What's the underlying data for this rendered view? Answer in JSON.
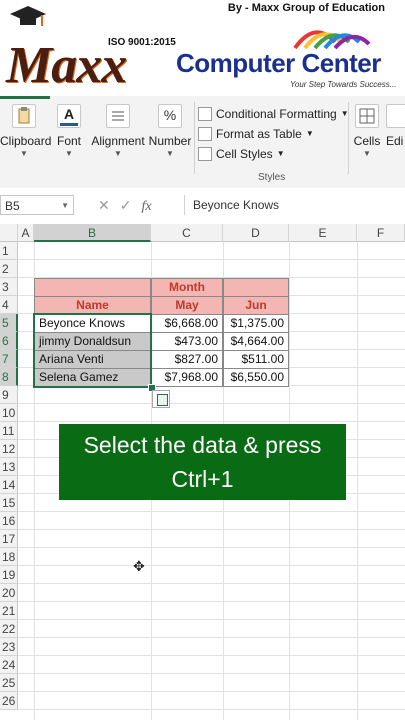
{
  "banner": {
    "by_text": "By - Maxx Group of Education",
    "iso": "ISO 9001:2015",
    "logo_text": "Maxx",
    "brand": "Computer Center",
    "tagline": "Your Step Towards Success..."
  },
  "ribbon": {
    "groups": [
      {
        "label": "Clipboard"
      },
      {
        "label": "Font"
      },
      {
        "label": "Alignment"
      },
      {
        "label": "Number"
      }
    ],
    "styles": {
      "conditional_formatting": "Conditional Formatting",
      "format_as_table": "Format as Table",
      "cell_styles": "Cell Styles",
      "group_label": "Styles"
    },
    "cells_label": "Cells",
    "editing_label": "Edi"
  },
  "formula_bar": {
    "name_box": "B5",
    "formula": "Beyonce Knows"
  },
  "grid": {
    "columns": [
      "A",
      "B",
      "C",
      "D",
      "E",
      "F"
    ],
    "rows": [
      "1",
      "2",
      "3",
      "4",
      "5",
      "6",
      "7",
      "8",
      "9",
      "10",
      "11",
      "12",
      "13",
      "14",
      "15",
      "16",
      "17",
      "18",
      "19",
      "20",
      "21",
      "22",
      "23",
      "24",
      "25",
      "26"
    ],
    "month_header": "Month",
    "name_header": "Name",
    "may_header": "May",
    "jun_header": "Jun",
    "data": [
      {
        "name": "Beyonce Knows",
        "may": "$6,668.00",
        "jun": "$1,375.00"
      },
      {
        "name": "jimmy Donaldsun",
        "may": "$473.00",
        "jun": "$4,664.00"
      },
      {
        "name": "Ariana Venti",
        "may": "$827.00",
        "jun": "$511.00"
      },
      {
        "name": "Selena Gamez",
        "may": "$7,968.00",
        "jun": "$6,550.00"
      }
    ]
  },
  "overlay": {
    "line1": "Select the data & press",
    "line2": "Ctrl+1"
  },
  "colors": {
    "excel_green": "#217346",
    "header_fill": "#f4b6b3",
    "header_text": "#c0392b",
    "toast_bg": "#0a6b15"
  }
}
